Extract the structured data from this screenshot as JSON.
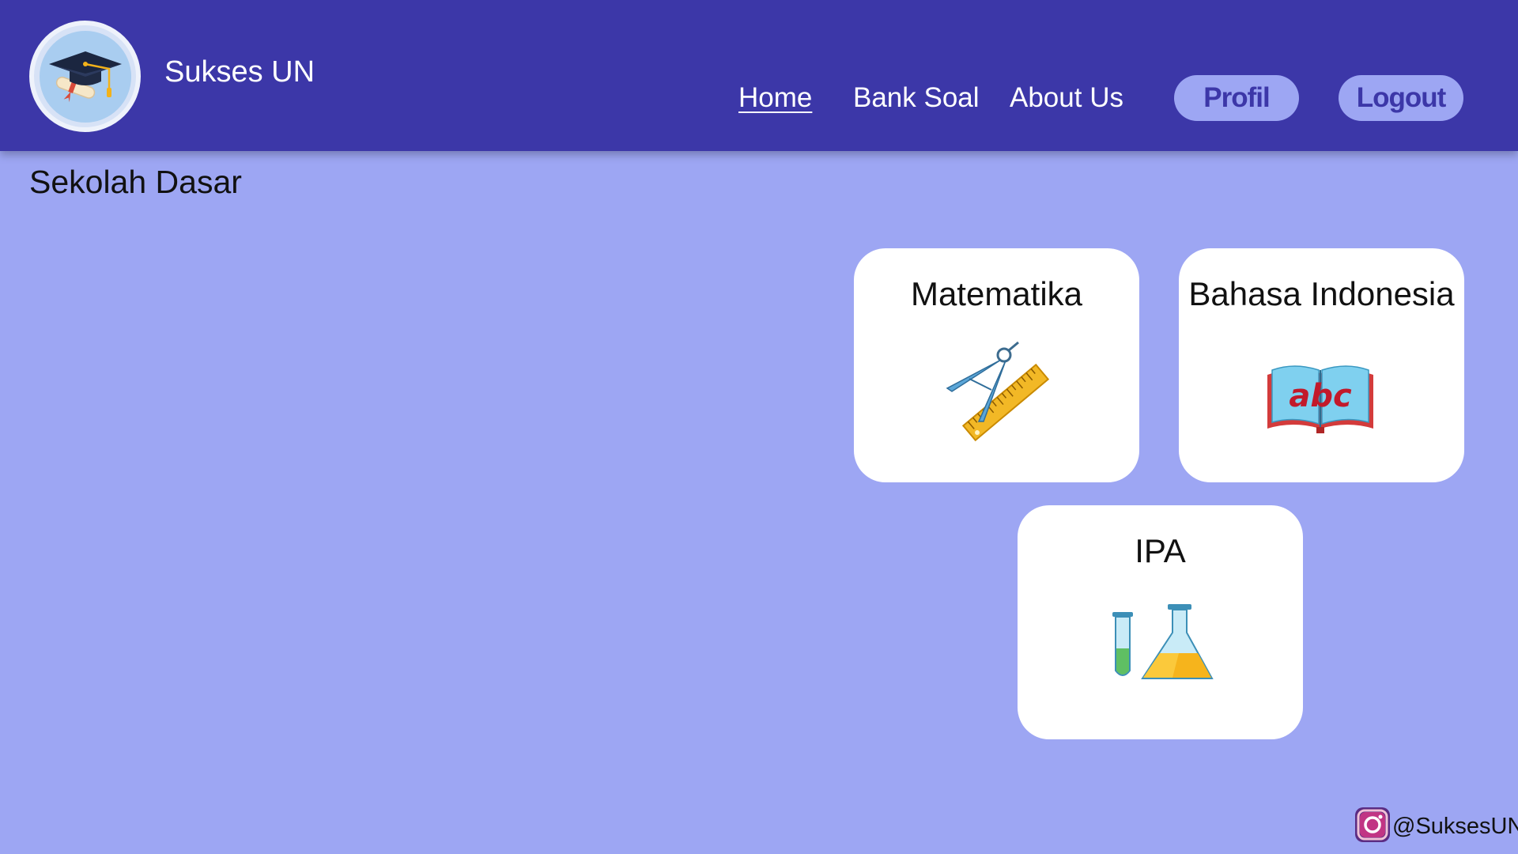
{
  "brand": {
    "name": "Sukses UN",
    "logo_icon": "graduation-cap-icon"
  },
  "nav": {
    "links": [
      {
        "label": "Home",
        "active": true
      },
      {
        "label": "Bank Soal",
        "active": false
      },
      {
        "label": "About Us",
        "active": false
      }
    ],
    "profile_button": "Profil",
    "logout_button": "Logout"
  },
  "page": {
    "title": "Sekolah Dasar"
  },
  "subjects": [
    {
      "name": "Matematika",
      "icon": "ruler-compass-icon"
    },
    {
      "name": "Bahasa Indonesia",
      "icon": "abc-book-icon"
    },
    {
      "name": "IPA",
      "icon": "lab-flask-icon"
    }
  ],
  "footer": {
    "social_handle": "@SuksesUN",
    "social_icon": "instagram-icon"
  },
  "colors": {
    "header": "#3c37a8",
    "background": "#9da6f3",
    "card": "#ffffff",
    "pill": "#9da6f3"
  }
}
